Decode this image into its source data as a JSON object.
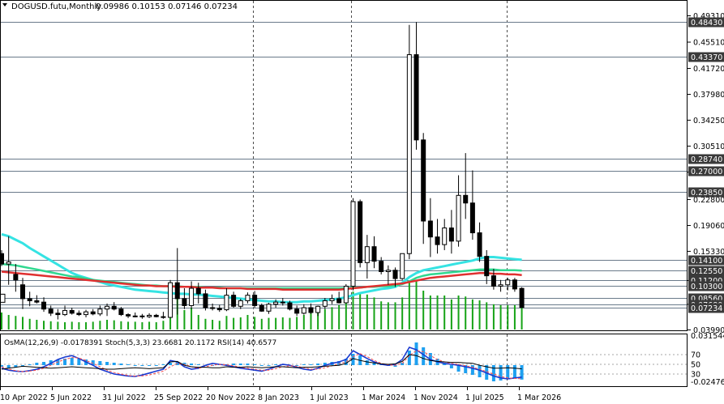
{
  "header": {
    "menu_icon": "triangle-down-icon",
    "symbol": "DOGUSD.futu,Monthly",
    "ohlc": "0.09986 0.10153 0.07146 0.07234"
  },
  "indicator_header": "OsMA(12,26,9) -0.0178391  Stoch(5,3,3) 23.6681 20.1172  RSI(14) 40.6577",
  "colors": {
    "bull": "#ffffff",
    "bear": "#000000",
    "wick": "#000000",
    "ma_cyan": "#35e3e3",
    "ma_green": "#30d890",
    "ma_red": "#e03030",
    "volume": "#16a316",
    "osma": "#1ea0f0",
    "stoch_main": "#1a3ad0",
    "stoch_signal": "#ff5050",
    "rsi": "#000000"
  },
  "chart_data": {
    "type": "candlestick",
    "price_ticks": [
      "0.49310",
      "0.45510",
      "0.41720",
      "0.37980",
      "0.34250",
      "0.30510",
      "0.26760",
      "0.22800",
      "0.19060",
      "0.15330",
      "0.11120",
      "0.07680",
      "0.03990"
    ],
    "price_levels": [
      "0.48430",
      "0.43370",
      "0.28740",
      "0.27000",
      "0.23850",
      "0.14100",
      "0.12550",
      "0.11200",
      "0.10300",
      "0.08560",
      "0.07680",
      "0.07234"
    ],
    "indicator_ticks": [
      "0.031544",
      "70",
      "50",
      "30",
      "-0.024768"
    ],
    "x_ticks": [
      "10 Apr 2022",
      "5 Jun 2022",
      "31 Jul 2022",
      "25 Sep 2022",
      "20 Nov 2022",
      "8 Jan 2023",
      "1 Jul 2023",
      "1 Mar 2024",
      "1 Nov 2024",
      "1 Jul 2025",
      "1 Mar 2026"
    ],
    "vlines_after_tick": [
      4,
      6,
      8
    ],
    "candles": [
      [
        0.15,
        0.155,
        0.132,
        0.135
      ],
      [
        0.135,
        0.175,
        0.105,
        0.138
      ],
      [
        0.12,
        0.135,
        0.095,
        0.112
      ],
      [
        0.105,
        0.115,
        0.07,
        0.085
      ],
      [
        0.085,
        0.095,
        0.074,
        0.082
      ],
      [
        0.082,
        0.09,
        0.078,
        0.08
      ],
      [
        0.08,
        0.087,
        0.066,
        0.07
      ],
      [
        0.07,
        0.075,
        0.06,
        0.064
      ],
      [
        0.064,
        0.07,
        0.055,
        0.062
      ],
      [
        0.062,
        0.075,
        0.06,
        0.068
      ],
      [
        0.068,
        0.072,
        0.062,
        0.064
      ],
      [
        0.064,
        0.068,
        0.06,
        0.062
      ],
      [
        0.062,
        0.069,
        0.058,
        0.066
      ],
      [
        0.066,
        0.07,
        0.061,
        0.063
      ],
      [
        0.063,
        0.075,
        0.06,
        0.07
      ],
      [
        0.07,
        0.078,
        0.06,
        0.074
      ],
      [
        0.074,
        0.08,
        0.068,
        0.07
      ],
      [
        0.07,
        0.073,
        0.06,
        0.062
      ],
      [
        0.062,
        0.064,
        0.057,
        0.06
      ],
      [
        0.06,
        0.065,
        0.058,
        0.06
      ],
      [
        0.06,
        0.063,
        0.056,
        0.059
      ],
      [
        0.059,
        0.064,
        0.057,
        0.061
      ],
      [
        0.061,
        0.063,
        0.058,
        0.059
      ],
      [
        0.059,
        0.066,
        0.056,
        0.058
      ],
      [
        0.058,
        0.112,
        0.057,
        0.108
      ],
      [
        0.108,
        0.158,
        0.062,
        0.085
      ],
      [
        0.085,
        0.1,
        0.07,
        0.075
      ],
      [
        0.075,
        0.11,
        0.07,
        0.1
      ],
      [
        0.1,
        0.108,
        0.078,
        0.092
      ],
      [
        0.092,
        0.098,
        0.068,
        0.072
      ],
      [
        0.072,
        0.078,
        0.068,
        0.071
      ],
      [
        0.071,
        0.076,
        0.066,
        0.069
      ],
      [
        0.069,
        0.1,
        0.067,
        0.09
      ],
      [
        0.09,
        0.095,
        0.072,
        0.074
      ],
      [
        0.074,
        0.085,
        0.07,
        0.082
      ],
      [
        0.082,
        0.094,
        0.078,
        0.09
      ],
      [
        0.09,
        0.096,
        0.072,
        0.075
      ],
      [
        0.075,
        0.078,
        0.066,
        0.067
      ],
      [
        0.067,
        0.079,
        0.063,
        0.077
      ],
      [
        0.077,
        0.084,
        0.072,
        0.08
      ],
      [
        0.08,
        0.086,
        0.075,
        0.079
      ],
      [
        0.079,
        0.082,
        0.068,
        0.07
      ],
      [
        0.07,
        0.075,
        0.06,
        0.064
      ],
      [
        0.064,
        0.077,
        0.062,
        0.072
      ],
      [
        0.072,
        0.078,
        0.063,
        0.065
      ],
      [
        0.065,
        0.075,
        0.06,
        0.074
      ],
      [
        0.074,
        0.086,
        0.07,
        0.082
      ],
      [
        0.082,
        0.091,
        0.077,
        0.085
      ],
      [
        0.085,
        0.095,
        0.078,
        0.079
      ],
      [
        0.079,
        0.106,
        0.078,
        0.103
      ],
      [
        0.103,
        0.23,
        0.097,
        0.225
      ],
      [
        0.225,
        0.228,
        0.13,
        0.137
      ],
      [
        0.137,
        0.177,
        0.114,
        0.16
      ],
      [
        0.16,
        0.175,
        0.129,
        0.139
      ],
      [
        0.139,
        0.145,
        0.12,
        0.124
      ],
      [
        0.124,
        0.133,
        0.105,
        0.126
      ],
      [
        0.126,
        0.13,
        0.102,
        0.114
      ],
      [
        0.114,
        0.15,
        0.112,
        0.15
      ],
      [
        0.15,
        0.48,
        0.142,
        0.437
      ],
      [
        0.437,
        0.484,
        0.3,
        0.314
      ],
      [
        0.314,
        0.324,
        0.164,
        0.197
      ],
      [
        0.197,
        0.23,
        0.145,
        0.174
      ],
      [
        0.174,
        0.2,
        0.15,
        0.163
      ],
      [
        0.163,
        0.2,
        0.155,
        0.187
      ],
      [
        0.187,
        0.213,
        0.15,
        0.168
      ],
      [
        0.168,
        0.263,
        0.16,
        0.234
      ],
      [
        0.234,
        0.295,
        0.2,
        0.223
      ],
      [
        0.223,
        0.27,
        0.17,
        0.18
      ],
      [
        0.18,
        0.195,
        0.138,
        0.146
      ],
      [
        0.146,
        0.155,
        0.106,
        0.118
      ],
      [
        0.118,
        0.128,
        0.098,
        0.103
      ],
      [
        0.103,
        0.112,
        0.095,
        0.105
      ],
      [
        0.105,
        0.115,
        0.097,
        0.112
      ],
      [
        0.112,
        0.115,
        0.095,
        0.099
      ],
      [
        0.09986,
        0.10153,
        0.07146,
        0.07234
      ]
    ],
    "ma_red": [
      0.124,
      0.123,
      0.122,
      0.121,
      0.12,
      0.119,
      0.118,
      0.117,
      0.116,
      0.115,
      0.114,
      0.113,
      0.112,
      0.111,
      0.11,
      0.109,
      0.108,
      0.107,
      0.106,
      0.105,
      0.104,
      0.104,
      0.103,
      0.103,
      0.103,
      0.102,
      0.102,
      0.102,
      0.101,
      0.101,
      0.101,
      0.1,
      0.1,
      0.1,
      0.1,
      0.099,
      0.099,
      0.099,
      0.099,
      0.099,
      0.098,
      0.098,
      0.098,
      0.098,
      0.098,
      0.098,
      0.098,
      0.098,
      0.098,
      0.099,
      0.1,
      0.101,
      0.102,
      0.103,
      0.104,
      0.105,
      0.106,
      0.107,
      0.109,
      0.111,
      0.113,
      0.115,
      0.116,
      0.117,
      0.118,
      0.119,
      0.12,
      0.121,
      0.122,
      0.122,
      0.121,
      0.121,
      0.12,
      0.12,
      0.119
    ],
    "ma_green": [
      0.135,
      0.134,
      0.133,
      0.131,
      0.129,
      0.127,
      0.125,
      0.123,
      0.121,
      0.119,
      0.117,
      0.116,
      0.114,
      0.112,
      0.111,
      0.11,
      0.109,
      0.108,
      0.107,
      0.106,
      0.105,
      0.104,
      0.104,
      0.103,
      0.103,
      0.103,
      0.102,
      0.102,
      0.102,
      0.101,
      0.101,
      0.101,
      0.1,
      0.1,
      0.1,
      0.1,
      0.1,
      0.1,
      0.1,
      0.1,
      0.1,
      0.1,
      0.1,
      0.1,
      0.1,
      0.1,
      0.1,
      0.1,
      0.1,
      0.1,
      0.101,
      0.101,
      0.102,
      0.102,
      0.103,
      0.103,
      0.104,
      0.106,
      0.11,
      0.115,
      0.118,
      0.12,
      0.121,
      0.122,
      0.123,
      0.124,
      0.125,
      0.126,
      0.127,
      0.127,
      0.127,
      0.126,
      0.126,
      0.126,
      0.1255
    ],
    "ma_cyan": [
      0.178,
      0.175,
      0.17,
      0.165,
      0.158,
      0.152,
      0.146,
      0.14,
      0.134,
      0.128,
      0.122,
      0.118,
      0.115,
      0.112,
      0.109,
      0.106,
      0.104,
      0.102,
      0.1,
      0.098,
      0.097,
      0.096,
      0.095,
      0.094,
      0.093,
      0.092,
      0.092,
      0.091,
      0.091,
      0.09,
      0.089,
      0.088,
      0.087,
      0.086,
      0.085,
      0.084,
      0.083,
      0.082,
      0.081,
      0.081,
      0.08,
      0.08,
      0.08,
      0.081,
      0.081,
      0.082,
      0.083,
      0.084,
      0.085,
      0.087,
      0.09,
      0.093,
      0.095,
      0.097,
      0.099,
      0.1,
      0.102,
      0.108,
      0.116,
      0.122,
      0.126,
      0.128,
      0.13,
      0.132,
      0.134,
      0.136,
      0.138,
      0.14,
      0.143,
      0.145,
      0.145,
      0.144,
      0.143,
      0.142,
      0.141
    ],
    "volume": [
      0.35,
      0.3,
      0.28,
      0.26,
      0.22,
      0.2,
      0.18,
      0.17,
      0.16,
      0.15,
      0.16,
      0.15,
      0.15,
      0.16,
      0.18,
      0.2,
      0.19,
      0.17,
      0.16,
      0.16,
      0.15,
      0.16,
      0.15,
      0.18,
      0.6,
      0.7,
      0.4,
      0.45,
      0.3,
      0.22,
      0.2,
      0.18,
      0.28,
      0.24,
      0.25,
      0.3,
      0.26,
      0.22,
      0.24,
      0.24,
      0.25,
      0.24,
      0.26,
      0.3,
      0.34,
      0.36,
      0.42,
      0.46,
      0.5,
      0.68,
      0.78,
      0.74,
      0.72,
      0.66,
      0.58,
      0.56,
      0.56,
      0.66,
      1.0,
      1.0,
      0.8,
      0.7,
      0.7,
      0.7,
      0.62,
      0.7,
      0.68,
      0.62,
      0.6,
      0.56,
      0.52,
      0.5,
      0.5,
      0.5,
      0.55
    ],
    "osma": [
      -0.002,
      -0.004,
      -0.003,
      -0.002,
      0.001,
      0.003,
      0.004,
      0.006,
      0.007,
      0.008,
      0.009,
      0.008,
      0.007,
      0.006,
      0.005,
      0.004,
      0.003,
      0.002,
      0.001,
      0.0,
      -0.001,
      -0.001,
      0.0,
      0.001,
      0.003,
      0.004,
      0.003,
      0.002,
      0.001,
      0.0,
      0.0,
      0.001,
      0.001,
      0.002,
      0.002,
      0.002,
      0.001,
      0.0,
      0.0,
      0.001,
      0.001,
      0.0,
      0.0,
      0.001,
      0.001,
      0.002,
      0.003,
      0.004,
      0.005,
      0.008,
      0.014,
      0.012,
      0.006,
      0.003,
      0.001,
      0.0,
      -0.002,
      0.003,
      0.018,
      0.028,
      0.022,
      0.015,
      0.008,
      0.002,
      -0.004,
      -0.008,
      -0.01,
      -0.012,
      -0.015,
      -0.018,
      -0.02,
      -0.019,
      -0.017,
      -0.016,
      -0.0178391
    ],
    "stoch_main": [
      42,
      38,
      36,
      35,
      37,
      40,
      45,
      52,
      60,
      65,
      68,
      62,
      55,
      48,
      40,
      35,
      30,
      28,
      26,
      25,
      28,
      32,
      36,
      40,
      58,
      55,
      45,
      40,
      42,
      48,
      52,
      50,
      48,
      45,
      42,
      40,
      38,
      36,
      40,
      45,
      50,
      48,
      44,
      40,
      38,
      42,
      48,
      52,
      55,
      60,
      78,
      70,
      62,
      55,
      50,
      48,
      50,
      60,
      85,
      80,
      70,
      60,
      55,
      52,
      50,
      48,
      45,
      42,
      38,
      32,
      26,
      22,
      20,
      22,
      23.6681
    ],
    "stoch_signal": [
      45,
      40,
      37,
      35,
      36,
      38,
      42,
      48,
      55,
      60,
      64,
      63,
      58,
      52,
      45,
      38,
      33,
      30,
      27,
      26,
      26,
      28,
      32,
      36,
      45,
      52,
      50,
      45,
      42,
      45,
      48,
      50,
      49,
      47,
      44,
      42,
      40,
      38,
      38,
      41,
      45,
      47,
      46,
      43,
      40,
      40,
      43,
      47,
      51,
      55,
      66,
      72,
      66,
      58,
      52,
      49,
      48,
      52,
      68,
      78,
      76,
      68,
      60,
      55,
      52,
      50,
      47,
      44,
      40,
      35,
      30,
      25,
      22,
      21,
      20.1172
    ],
    "rsi": [
      40,
      42,
      44,
      46,
      45,
      44,
      43,
      42,
      43,
      44,
      45,
      44,
      43,
      42,
      41,
      40,
      40,
      41,
      42,
      43,
      42,
      41,
      42,
      43,
      55,
      56,
      48,
      45,
      44,
      44,
      43,
      43,
      45,
      44,
      44,
      45,
      44,
      43,
      44,
      45,
      45,
      44,
      43,
      44,
      44,
      45,
      46,
      47,
      48,
      52,
      62,
      58,
      55,
      53,
      51,
      50,
      51,
      56,
      70,
      68,
      62,
      58,
      56,
      55,
      54,
      54,
      53,
      52,
      48,
      45,
      42,
      42,
      43,
      42,
      40.6577
    ]
  }
}
